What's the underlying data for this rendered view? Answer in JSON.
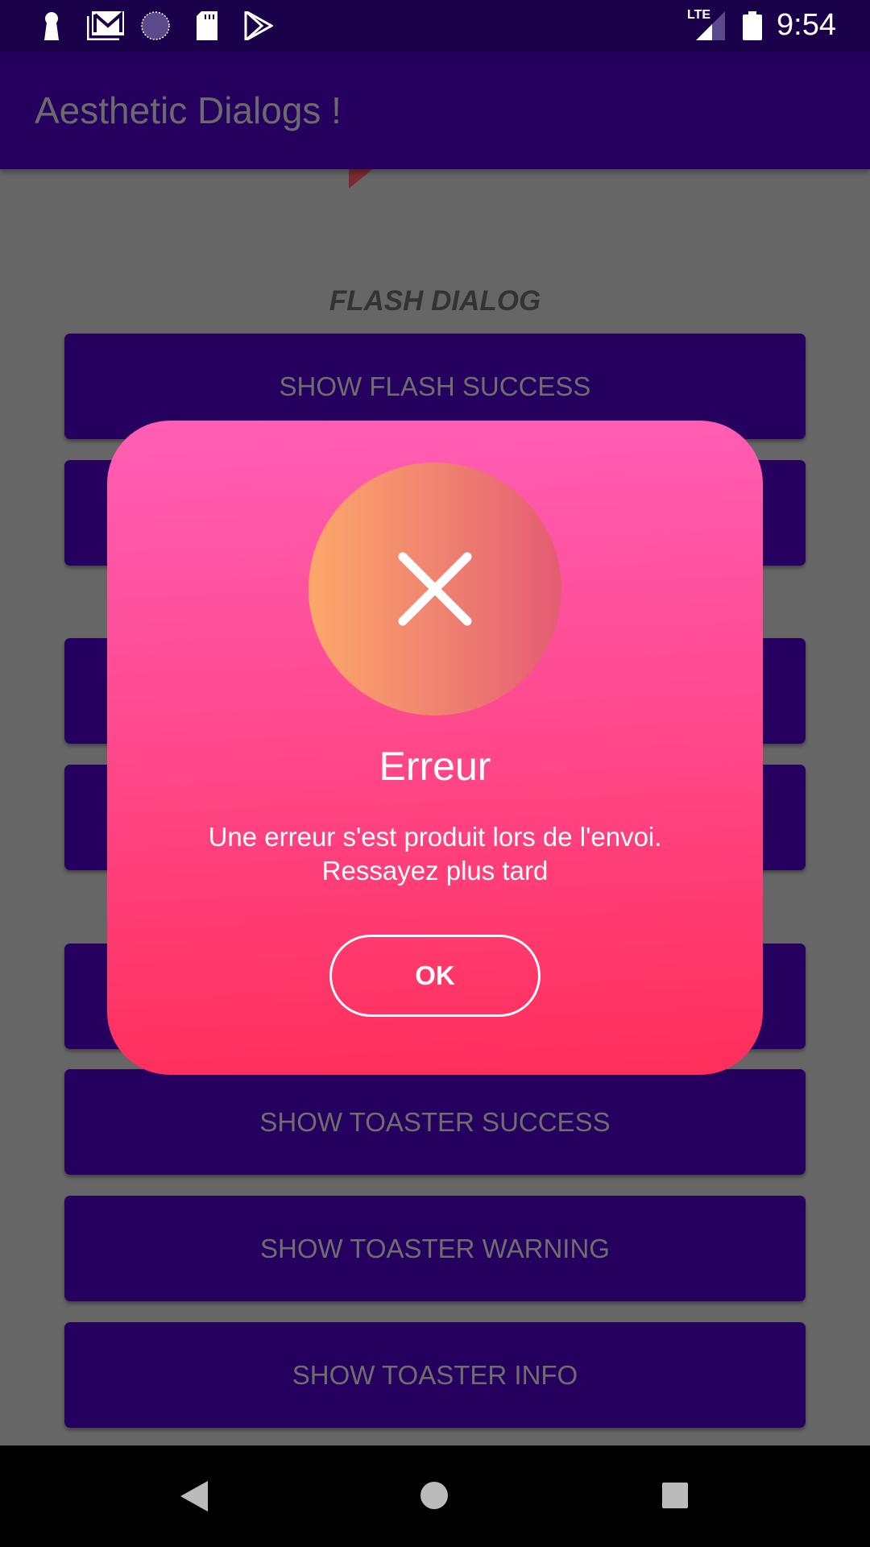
{
  "status_bar": {
    "time": "9:54",
    "network": "LTE",
    "icons": [
      "keyhole-icon",
      "gmail-icon",
      "sync-icon",
      "sd-card-icon",
      "play-store-icon",
      "lte-signal-icon",
      "battery-icon"
    ]
  },
  "app_bar": {
    "title": "Aesthetic Dialogs !"
  },
  "main": {
    "section_title": "FLASH DIALOG",
    "buttons": [
      {
        "label": "SHOW FLASH SUCCESS"
      },
      {
        "label": ""
      },
      {
        "label": ""
      },
      {
        "label": ""
      },
      {
        "label": ""
      },
      {
        "label": "SHOW TOASTER SUCCESS"
      },
      {
        "label": "SHOW TOASTER WARNING"
      },
      {
        "label": "SHOW TOASTER INFO"
      }
    ]
  },
  "dialog": {
    "icon": "close-x-icon",
    "title": "Erreur",
    "message_line1": "Une erreur s'est produit lors de l'envoi.",
    "message_line2": "Ressayez plus tard",
    "ok_label": "OK",
    "colors": {
      "gradient_top": "#ff5eb6",
      "gradient_bottom": "#ff2e5a",
      "icon_circle_left": "#fda76a",
      "icon_circle_right": "#e45c72"
    }
  },
  "nav_bar": {
    "icons": [
      "back-icon",
      "home-icon",
      "recents-icon"
    ]
  }
}
